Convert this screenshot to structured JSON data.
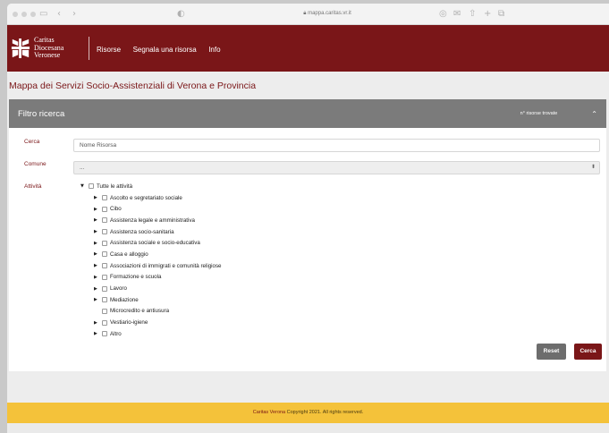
{
  "browser": {
    "url": "mappa.caritas.vr.it"
  },
  "logo": {
    "line1": "Caritas",
    "line2": "Diocesana",
    "line3": "Veronese"
  },
  "nav": {
    "items": [
      "Risorse",
      "Segnala una risorsa",
      "Info"
    ]
  },
  "page": {
    "title": "Mappa dei Servizi Socio-Assistenziali di Verona e Provincia"
  },
  "filter": {
    "title": "Filtro ricerca",
    "count_label": "n° risorse trovate",
    "search": {
      "label": "Cerca",
      "placeholder": "Nome Risorsa"
    },
    "comune": {
      "label": "Comune",
      "value": "..."
    },
    "attivita": {
      "label": "Attività",
      "root": "Tutte le attività",
      "items": [
        "Ascolto e segretariato sociale",
        "Cibo",
        "Assistenza legale e amministrativa",
        "Assistenza socio-sanitaria",
        "Assistenza sociale e socio-educativa",
        "Casa e alloggio",
        "Associazioni di immigrati e comunità religiose",
        "Formazione e scuola",
        "Lavoro",
        "Mediazione",
        "Microcredito e antiusura",
        "Vestiario-igiene",
        "Altro"
      ]
    },
    "reset_label": "Reset",
    "cerca_label": "Cerca"
  },
  "footer": {
    "brand": "Caritas Verona",
    "text": " Copyright 2021. All rights reserved."
  },
  "colors": {
    "brand": "#7a1618",
    "panel_header": "#7b7b7b",
    "footer": "#f4c23a"
  },
  "icons": [
    "sidebar-icon",
    "back-icon",
    "forward-icon",
    "shield-icon",
    "lock-icon",
    "translate-icon",
    "mail-icon",
    "share-icon",
    "new-tab-icon",
    "tabs-icon",
    "chevron-up-icon",
    "select-arrows-icon",
    "caret-right-icon",
    "caret-down-icon"
  ]
}
